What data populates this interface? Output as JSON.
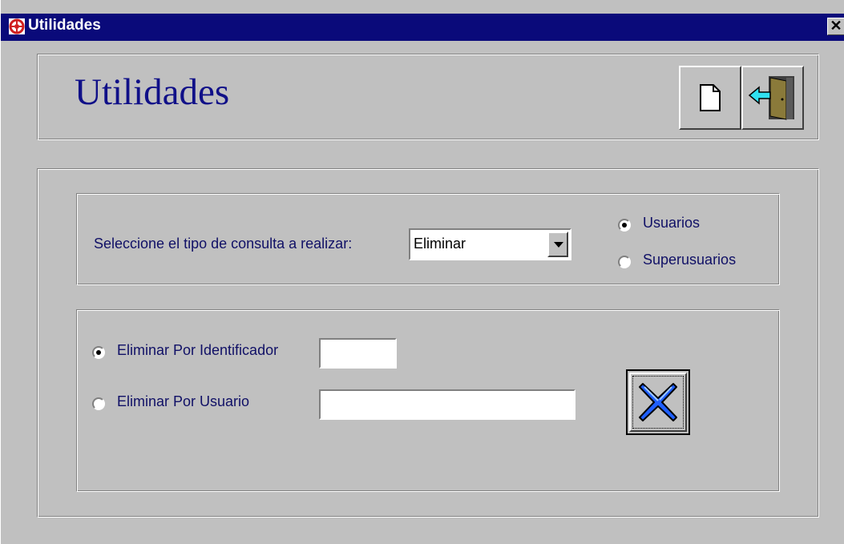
{
  "window": {
    "title": "Utilidades",
    "close_glyph": "✕",
    "app_icon": "life-ring-icon"
  },
  "header": {
    "title": "Utilidades",
    "new_button_icon": "document-icon",
    "exit_button_icon": "exit-door-icon"
  },
  "query": {
    "label": "Seleccione el tipo de consulta a realizar:",
    "selected_value": "Eliminar",
    "user_type_options": [
      {
        "label": "Usuarios",
        "checked": true
      },
      {
        "label": "Superusuarios",
        "checked": false
      }
    ]
  },
  "delete_by": {
    "options": [
      {
        "label": "Eliminar Por Identificador",
        "checked": true,
        "value": ""
      },
      {
        "label": "Eliminar Por Usuario",
        "checked": false,
        "value": ""
      }
    ],
    "delete_button_icon": "blue-x-icon"
  },
  "colors": {
    "titlebar": "#0a0a7a",
    "face": "#c0c0c0",
    "title_text": "#101088",
    "label_text": "#101066",
    "x_blue": "#1f5fff"
  }
}
